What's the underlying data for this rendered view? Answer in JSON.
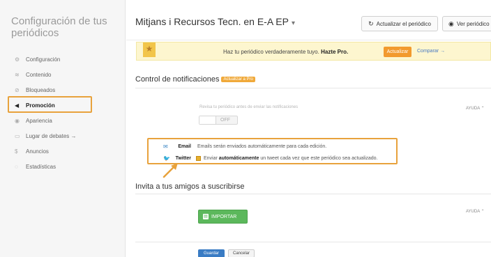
{
  "sidebar": {
    "title": "Configuración de tus periódicos",
    "items": [
      {
        "icon": "sliders-icon",
        "glyph": "⚙",
        "label": "Configuración"
      },
      {
        "icon": "layers-icon",
        "glyph": "≋",
        "label": "Contenido"
      },
      {
        "icon": "block-icon",
        "glyph": "⊘",
        "label": "Bloqueados"
      },
      {
        "icon": "megaphone-icon",
        "glyph": "◀",
        "label": "Promoción",
        "active": true
      },
      {
        "icon": "palette-icon",
        "glyph": "◉",
        "label": "Apariencia"
      },
      {
        "icon": "chat-icon",
        "glyph": "▭",
        "label": "Lugar de debates →"
      },
      {
        "icon": "dollar-icon",
        "glyph": "$",
        "label": "Anuncios"
      },
      {
        "icon": "stats-icon",
        "glyph": "◌",
        "label": "Estadísticas"
      }
    ]
  },
  "header": {
    "site_title": "Mitjans i Recursos Tecn. en E-A EP",
    "caret": "▾",
    "refresh_label": "Actualizar el periódico",
    "view_label": "Ver periódico"
  },
  "promo": {
    "text_prefix": "Haz tu periódico verdaderamente tuyo.",
    "text_bold": "Hazte Pro.",
    "button": "Actualizar",
    "link": "Comparar →"
  },
  "notifications": {
    "title": "Control de notificaciones",
    "upgrade_tag": "Actualizar a Pro",
    "hint": "Revisa tu periódico antes de enviar las notificaciones",
    "toggle_state": "OFF",
    "help": "AYUDA",
    "email_label": "Email",
    "email_desc": "Emails serán enviados automáticamente para cada edición.",
    "twitter_label": "Twitter",
    "twitter_desc_prefix": "Enviar",
    "twitter_desc_bold": "automáticamente",
    "twitter_desc_suffix": "un tweet cada vez que este periódico sea actualizado."
  },
  "invite": {
    "title": "Invita a tus amigos a suscribirse",
    "import_button": "IMPORTAR",
    "help": "AYUDA"
  },
  "footer": {
    "save": "Guardar",
    "cancel": "Cancelar"
  },
  "colors": {
    "highlight": "#e8a23c",
    "primary": "#3a7cc4",
    "success": "#5cb85c",
    "promo_bg": "#fdf6cf"
  }
}
